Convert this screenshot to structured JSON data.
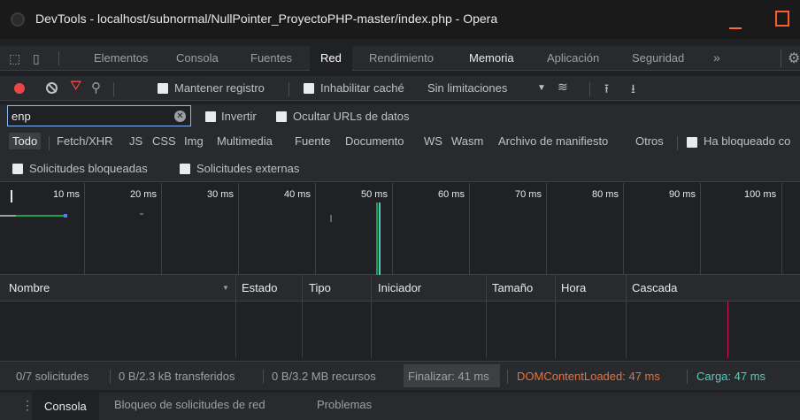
{
  "window": {
    "title": "DevTools - localhost/subnormal/NullPointer_ProyectoPHP-master/index.php - Opera"
  },
  "tabs": [
    "Elementos",
    "Consola",
    "Fuentes",
    "Red",
    "Rendimiento",
    "Memoria",
    "Aplicación",
    "Seguridad"
  ],
  "tabs_more": "»",
  "toolbar": {
    "preserve_log": "Mantener registro",
    "disable_cache": "Inhabilitar caché",
    "throttling": "Sin limitaciones"
  },
  "filter": {
    "value": "enp",
    "invert": "Invertir",
    "hide_data_urls": "Ocultar URLs de datos"
  },
  "types": [
    "Todo",
    "Fetch/XHR",
    "JS",
    "CSS",
    "Img",
    "Multimedia",
    "Fuente",
    "Documento",
    "WS",
    "Wasm",
    "Archivo de manifiesto",
    "Otros"
  ],
  "has_blocked": "Ha bloqueado co",
  "blocked_requests": "Solicitudes bloqueadas",
  "third_party": "Solicitudes externas",
  "timeline_ticks": [
    "10 ms",
    "20 ms",
    "30 ms",
    "40 ms",
    "50 ms",
    "60 ms",
    "70 ms",
    "80 ms",
    "90 ms",
    "100 ms"
  ],
  "columns": [
    "Nombre",
    "Estado",
    "Tipo",
    "Iniciador",
    "Tamaño",
    "Hora",
    "Cascada"
  ],
  "status": {
    "requests": "0/7 solicitudes",
    "transferred": "0 B/2.3 kB transferidos",
    "resources": "0 B/3.2 MB recursos",
    "finish": "Finalizar: 41 ms",
    "dom_loaded": "DOMContentLoaded: 47 ms",
    "load": "Carga: 47 ms"
  },
  "drawer_tabs": [
    "Consola",
    "Bloqueo de solicitudes de red",
    "Problemas"
  ],
  "colors": {
    "accent_blue": "#8ab4f8",
    "record_red": "#e94747",
    "dom_loaded": "#e8713a",
    "load": "#4dd0c0"
  },
  "icons": [
    "opera-icon",
    "minimize-icon",
    "maximize-icon",
    "inspect-icon",
    "device-toolbar-icon",
    "record-icon",
    "clear-icon",
    "filter-icon",
    "search-icon",
    "wifi-icon",
    "upload-icon",
    "download-icon",
    "gear-icon",
    "kebab-icon"
  ]
}
